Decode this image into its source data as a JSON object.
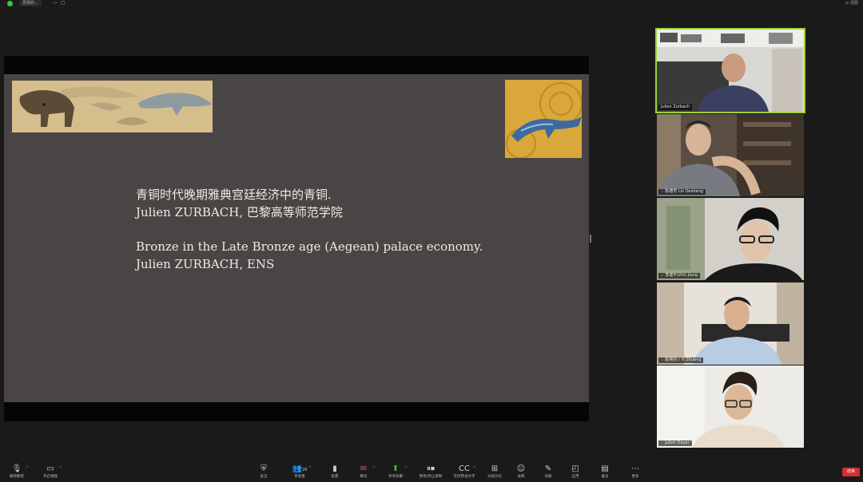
{
  "top_bar": {
    "tab_label": "思想的...",
    "controls": [
      "—",
      "▢"
    ],
    "right_label": "◎ 视图"
  },
  "slide": {
    "lines": [
      "青铜时代晚期雅典宫廷经济中的青铜.",
      "Julien ZURBACH, 巴黎高等师范学院",
      "Bronze in the Late Bronze age (Aegean) palace economy.",
      "Julien ZURBACH, ENS"
    ]
  },
  "participants": [
    {
      "name": "Julien Zurbach",
      "speaking": true
    },
    {
      "name": "陈德然 Lin Desheng",
      "speaking": false
    },
    {
      "name": "李建平(Zhi) Jiang",
      "speaking": false
    },
    {
      "name": "陈英凯 ( Yi Zhuang",
      "speaking": false
    },
    {
      "name": "Julien Dayer",
      "speaking": false
    }
  ],
  "toolbar": {
    "left": [
      {
        "icon": "microphone-icon",
        "label": "解除静音"
      },
      {
        "icon": "video-camera-icon",
        "label": "开启视频"
      }
    ],
    "center": [
      {
        "icon": "security-shield-icon",
        "label": "安全"
      },
      {
        "icon": "participants-icon",
        "label": "参会者",
        "badge": "20"
      },
      {
        "icon": "poll-icon",
        "label": "投票"
      },
      {
        "icon": "chat-icon",
        "label": "聊天"
      },
      {
        "icon": "share-screen-icon",
        "label": "共享屏幕"
      },
      {
        "icon": "record-icon",
        "label": "暂停/停止录制"
      },
      {
        "icon": "live-caption-icon",
        "label": "实时转录文字"
      },
      {
        "icon": "breakout-rooms-icon",
        "label": "分组讨论"
      },
      {
        "icon": "reactions-icon",
        "label": "表情"
      },
      {
        "icon": "whiteboard-icon",
        "label": "白板"
      },
      {
        "icon": "apps-icon",
        "label": "应用"
      },
      {
        "icon": "notes-icon",
        "label": "备注"
      },
      {
        "icon": "more-icon",
        "label": "更多"
      }
    ],
    "end_label": "结束"
  },
  "colors": {
    "slide_bg": "#4a4545",
    "active_speaker_border": "#9fd13a",
    "end_button": "#d03030",
    "share_active": "#2ecc40"
  }
}
